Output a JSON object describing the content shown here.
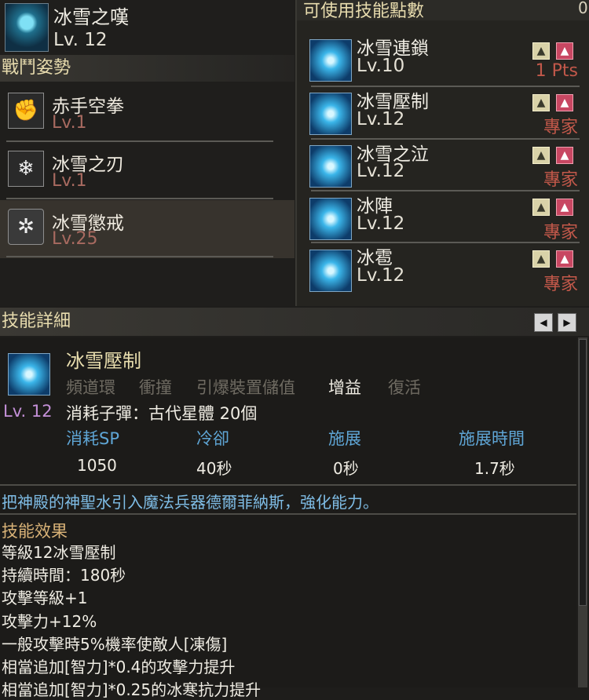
{
  "character": {
    "name": "冰雪之嘆",
    "level": "Lv. 12"
  },
  "stance": {
    "header": "戰鬥姿勢",
    "items": [
      {
        "name": "赤手空拳",
        "level": "Lv.1",
        "icon": "fist-icon"
      },
      {
        "name": "冰雪之刃",
        "level": "Lv.1",
        "icon": "ice-blade-icon"
      },
      {
        "name": "冰雪懲戒",
        "level": "Lv.25",
        "icon": "snowflake-badge-icon"
      }
    ]
  },
  "points": {
    "label": "可使用技能點數",
    "value": "0"
  },
  "skills": [
    {
      "name": "冰雪連鎖",
      "level": "Lv.10",
      "tag": "1 Pts"
    },
    {
      "name": "冰雪壓制",
      "level": "Lv.12",
      "tag": "專家"
    },
    {
      "name": "冰雪之泣",
      "level": "Lv.12",
      "tag": "專家"
    },
    {
      "name": "冰陣",
      "level": "Lv.12",
      "tag": "專家"
    },
    {
      "name": "冰雹",
      "level": "Lv.12",
      "tag": "專家"
    }
  ],
  "detail": {
    "header": "技能詳細",
    "name": "冰雪壓制",
    "tags": [
      {
        "label": "頻道環",
        "active": false
      },
      {
        "label": "衝撞",
        "active": false
      },
      {
        "label": "引爆裝置儲值",
        "active": false
      },
      {
        "label": "增益",
        "active": true
      },
      {
        "label": "復活",
        "active": false
      }
    ],
    "level": "Lv. 12",
    "ammo": "消耗子彈：古代星體 20個",
    "stats": [
      {
        "label": "消耗SP",
        "value": "1050"
      },
      {
        "label": "冷卻",
        "value": "40秒"
      },
      {
        "label": "施展",
        "value": "0秒"
      },
      {
        "label": "施展時間",
        "value": "1.7秒"
      }
    ],
    "description": "把神殿的神聖水引入魔法兵器德爾菲納斯，強化能力。",
    "effect_title": "技能效果",
    "effects": [
      "等級12冰雪壓制",
      "持續時間：180秒",
      "攻擊等級+1",
      "攻擊力+12%",
      "一般攻擊時5%機率使敵人[凍傷]",
      "相當追加[智力]*0.4的攻擊力提升",
      "相當追加[智力]*0.25的冰寒抗力提升"
    ]
  },
  "colors": {
    "accent_gold": "#e8dcae",
    "level_red": "#c2584a",
    "stat_blue": "#5fa6d6",
    "level_purple": "#c490d8"
  }
}
